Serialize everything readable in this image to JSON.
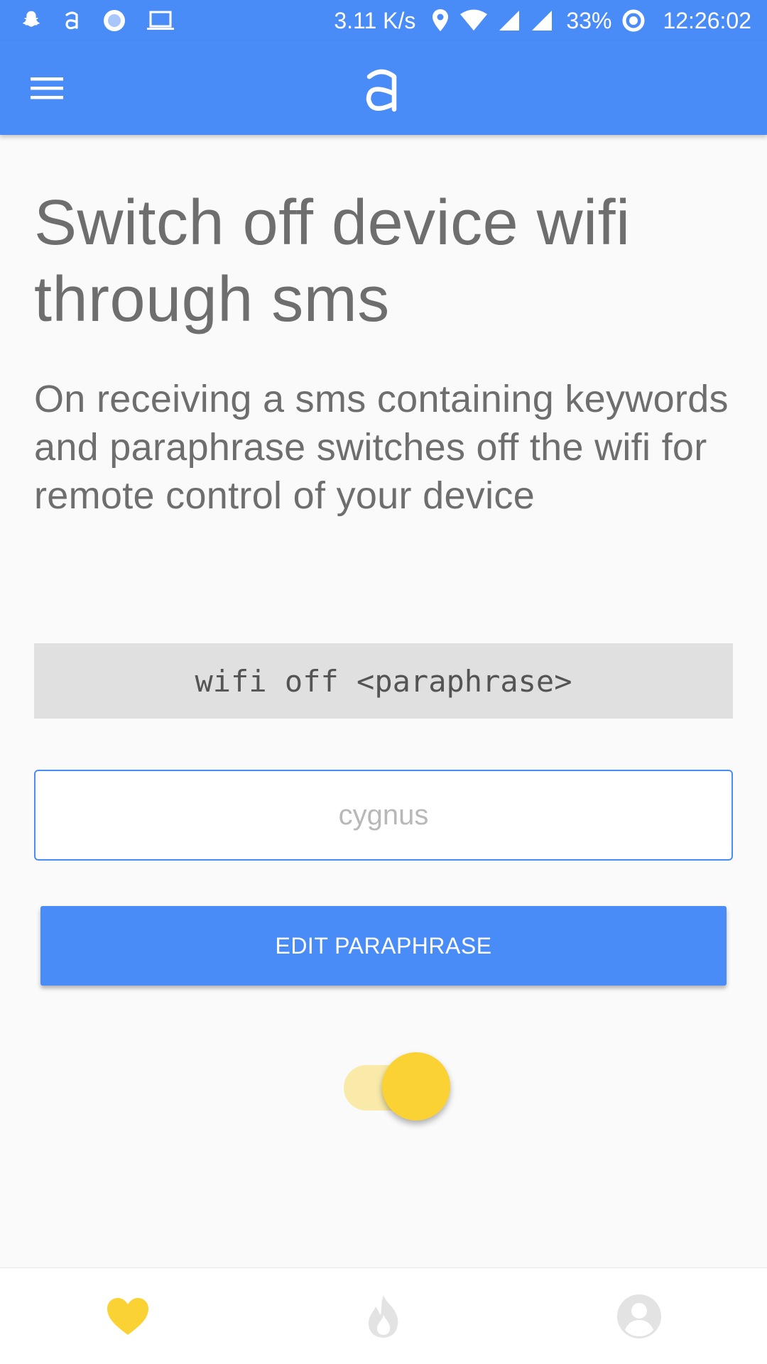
{
  "status_bar": {
    "network_speed": "3.11 K/s",
    "battery": "33%",
    "time": "12:26:02",
    "left_icons": [
      "snapchat-icon",
      "app-logo-icon",
      "record-icon",
      "laptop-icon"
    ],
    "right_icons": [
      "location-icon",
      "wifi-icon",
      "signal-icon",
      "signal-icon",
      "battery-ring-icon"
    ]
  },
  "app_bar": {
    "menu_icon": "hamburger-menu-icon",
    "logo_icon": "app-logo-icon"
  },
  "main": {
    "title": "Switch off device wifi through sms",
    "description": "On receiving a sms containing keywords and paraphrase switches off the wifi for remote control of your device",
    "command": "wifi off <paraphrase>",
    "paraphrase_input": {
      "value": "",
      "placeholder": "cygnus"
    },
    "edit_button_label": "EDIT PARAPHRASE",
    "toggle_on": true
  },
  "bottom_nav": {
    "items": [
      {
        "icon": "heart-icon",
        "active": true
      },
      {
        "icon": "flame-icon",
        "active": false
      },
      {
        "icon": "profile-icon",
        "active": false
      }
    ]
  },
  "colors": {
    "primary": "#4a8cf7",
    "accent": "#fbd233",
    "text": "#6e6e6e"
  }
}
